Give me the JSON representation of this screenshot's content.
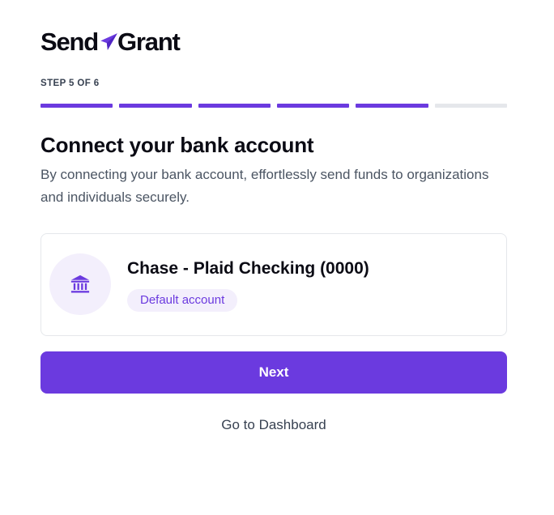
{
  "brand": {
    "name_left": "Send",
    "name_right": "Grant",
    "accent": "#6b3adf",
    "logo_icon": "paper-plane-icon"
  },
  "stepper": {
    "label": "STEP 5 OF 6",
    "current": 5,
    "total": 6
  },
  "heading": {
    "title": "Connect your bank account",
    "subtitle": "By connecting your bank account, effortlessly send funds to organizations and individuals securely."
  },
  "account": {
    "icon": "bank-icon",
    "name": "Chase - Plaid Checking (0000)",
    "badge": "Default account"
  },
  "actions": {
    "next_label": "Next",
    "dashboard_label": "Go to Dashboard"
  },
  "colors": {
    "primary": "#6b3adf",
    "progress_inactive": "#e5e7eb",
    "badge_bg": "#f3effc"
  }
}
